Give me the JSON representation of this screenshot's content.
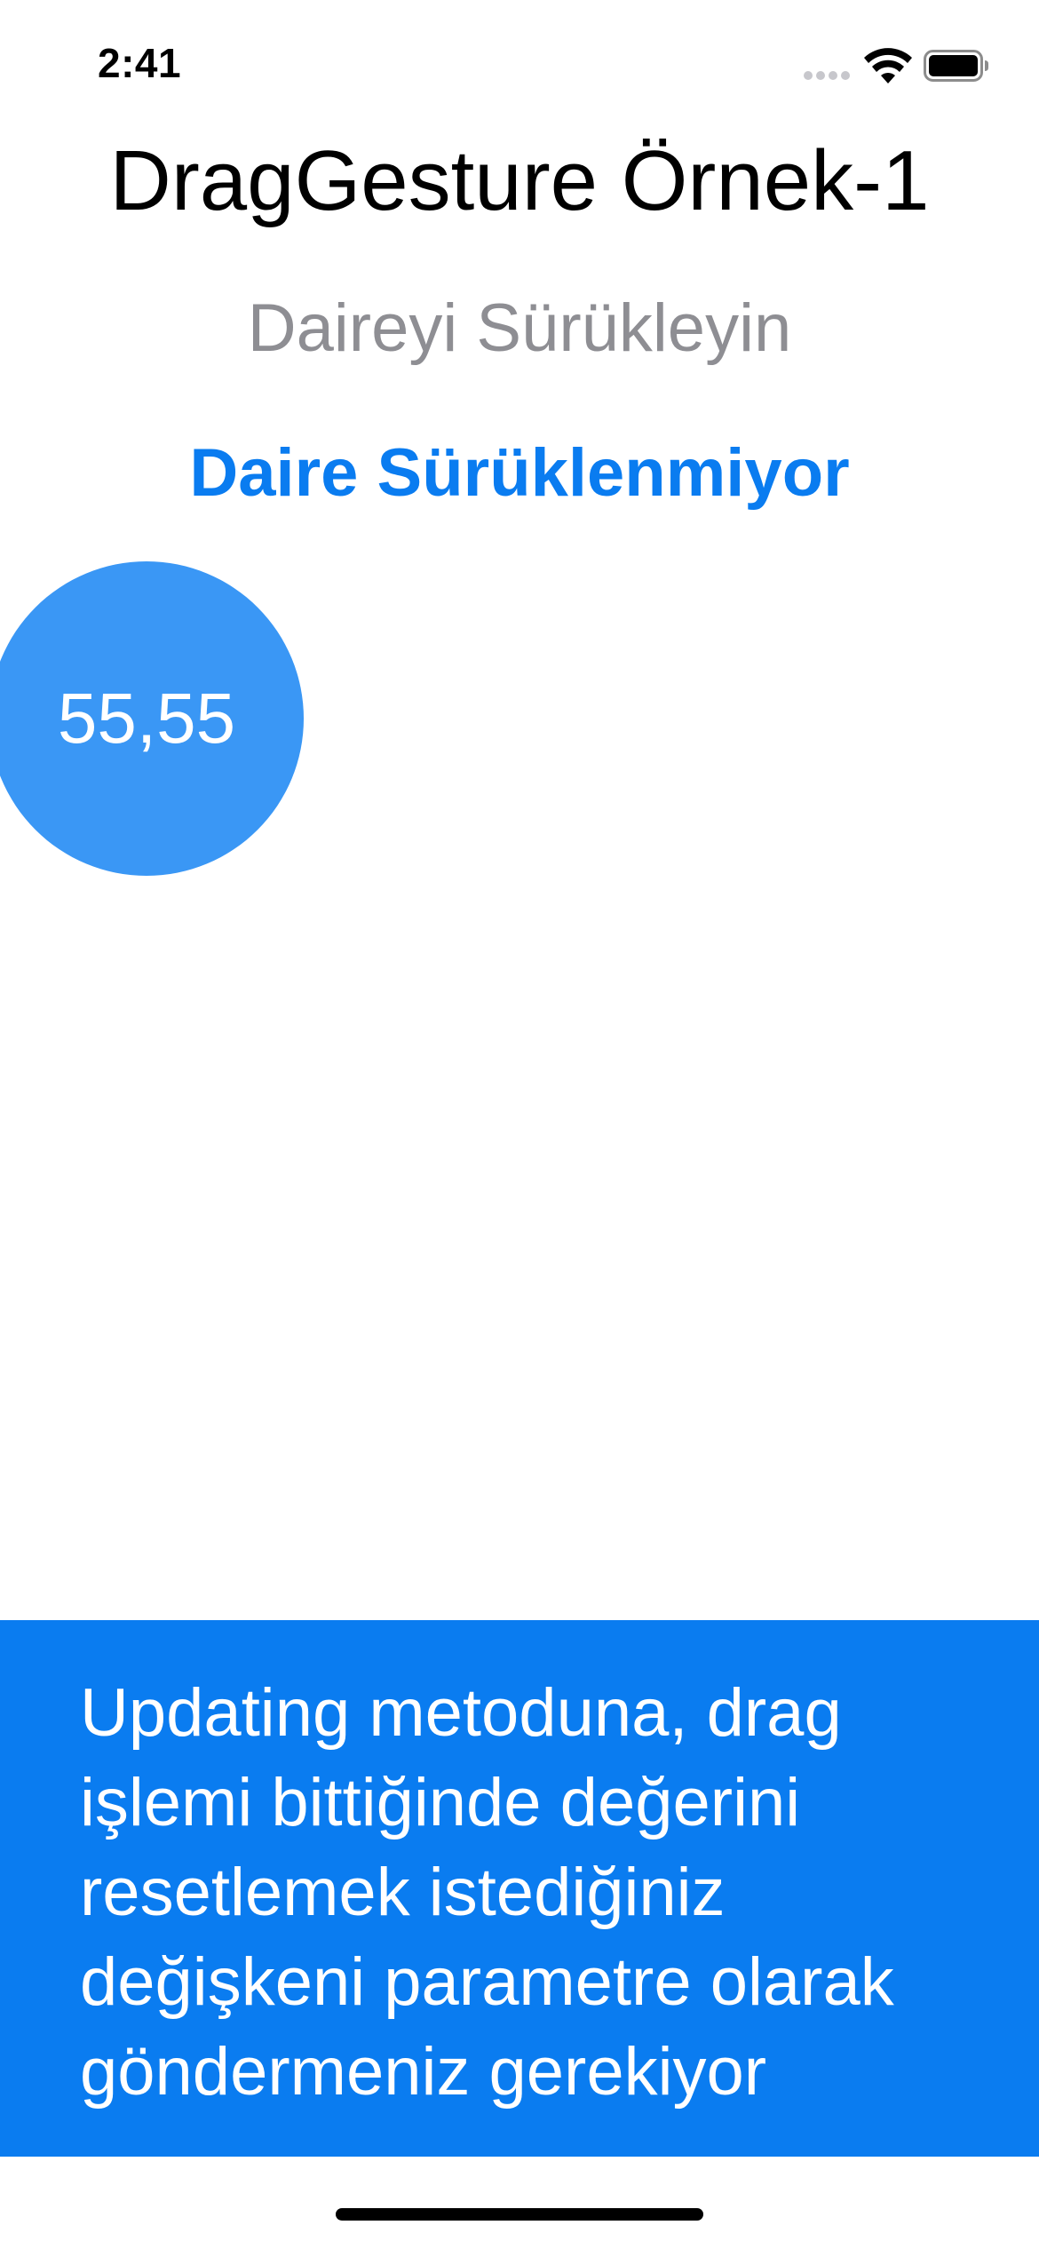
{
  "status_bar": {
    "time": "2:41",
    "icons": [
      "cellular-signal-icon",
      "wifi-icon",
      "battery-icon"
    ]
  },
  "header": {
    "title": "DragGesture Örnek-1",
    "subtitle": "Daireyi Sürükleyin",
    "status": "Daire Sürüklenmiyor"
  },
  "circle": {
    "label": "55,55"
  },
  "info_panel": {
    "text": "Updating metoduna, drag işlemi bittiğinde değerini resetlemek istediğiniz değişkeni parametre olarak göndermeniz gerekiyor"
  },
  "colors": {
    "accent": "#0a7cf0",
    "circle_fill": "#3a97f5",
    "subtitle_gray": "#8e8e93",
    "background": "#ffffff"
  }
}
